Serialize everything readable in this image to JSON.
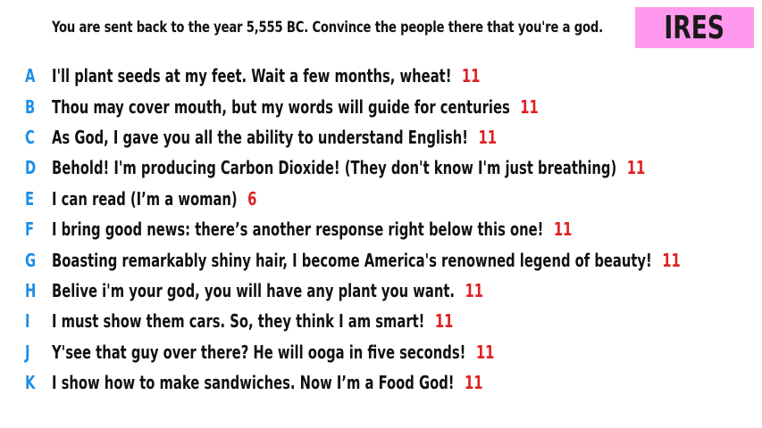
{
  "prompt": "You are sent back to the year 5,555 BC. Convince the people there that you're a god.",
  "badge": {
    "label": "IRES",
    "color": "#ff99ee"
  },
  "colors": {
    "letter": "#1f8ee8",
    "score": "#e02020",
    "text": "#111111"
  },
  "answers": [
    {
      "letter": "A",
      "text": "I'll plant seeds at my feet. Wait a few months, wheat!",
      "score": "11"
    },
    {
      "letter": "B",
      "text": "Thou may cover mouth, but my words will guide for centuries",
      "score": "11"
    },
    {
      "letter": "C",
      "text": "As God, I gave you all the ability to understand English!",
      "score": "11"
    },
    {
      "letter": "D",
      "text": "Behold! I'm producing Carbon Dioxide! (They don't know I'm just breathing)",
      "score": "11"
    },
    {
      "letter": "E",
      "text": "I can read (I’m a woman)",
      "score": "6"
    },
    {
      "letter": "F",
      "text": "I bring good news: there’s another response right below this one!",
      "score": "11"
    },
    {
      "letter": "G",
      "text": "Boasting remarkably shiny hair, I become America's renowned legend of beauty!",
      "score": "11"
    },
    {
      "letter": "H",
      "text": "Belive i'm your god, you will have any plant you want.",
      "score": "11"
    },
    {
      "letter": "I",
      "text": "I must show them cars. So, they think I am smart!",
      "score": "11"
    },
    {
      "letter": "J",
      "text": "Y'see that guy over there? He will ooga in five seconds!",
      "score": "11"
    },
    {
      "letter": "K",
      "text": "I show how to make sandwiches. Now I’m a Food God!",
      "score": "11"
    }
  ]
}
